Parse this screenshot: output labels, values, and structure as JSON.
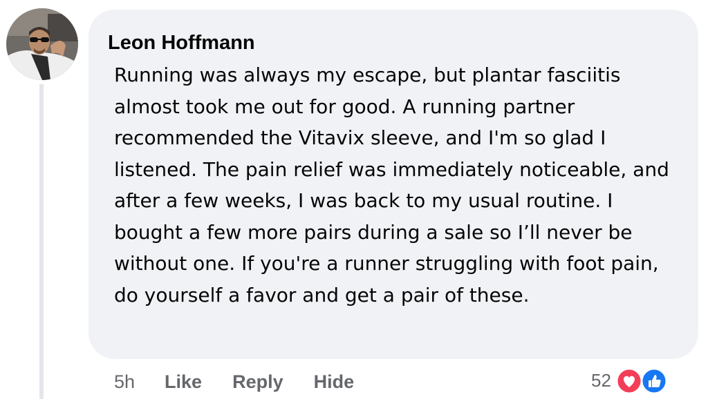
{
  "comment": {
    "author": "Leon Hoffmann",
    "text": "Running was always my escape, but plantar fasciitis almost took me out for good. A running partner recommended the Vitavix sleeve, and I'm so glad I listened. The pain relief was immediately noticeable, and after a few weeks, I was back to my usual routine. I bought a few more pairs during a sale so I’ll never be without one. If you're a runner struggling with foot pain, do yourself a favor and get a pair of these.",
    "time": "5h",
    "actions": {
      "like": "Like",
      "reply": "Reply",
      "hide": "Hide"
    },
    "reactions": {
      "count": "52",
      "icons": [
        "love-icon",
        "like-icon"
      ]
    }
  },
  "colors": {
    "bubble_bg": "#f0f2f5",
    "text": "#050505",
    "secondary_text": "#65676b",
    "love": "#f33e58",
    "like": "#1877f2"
  }
}
